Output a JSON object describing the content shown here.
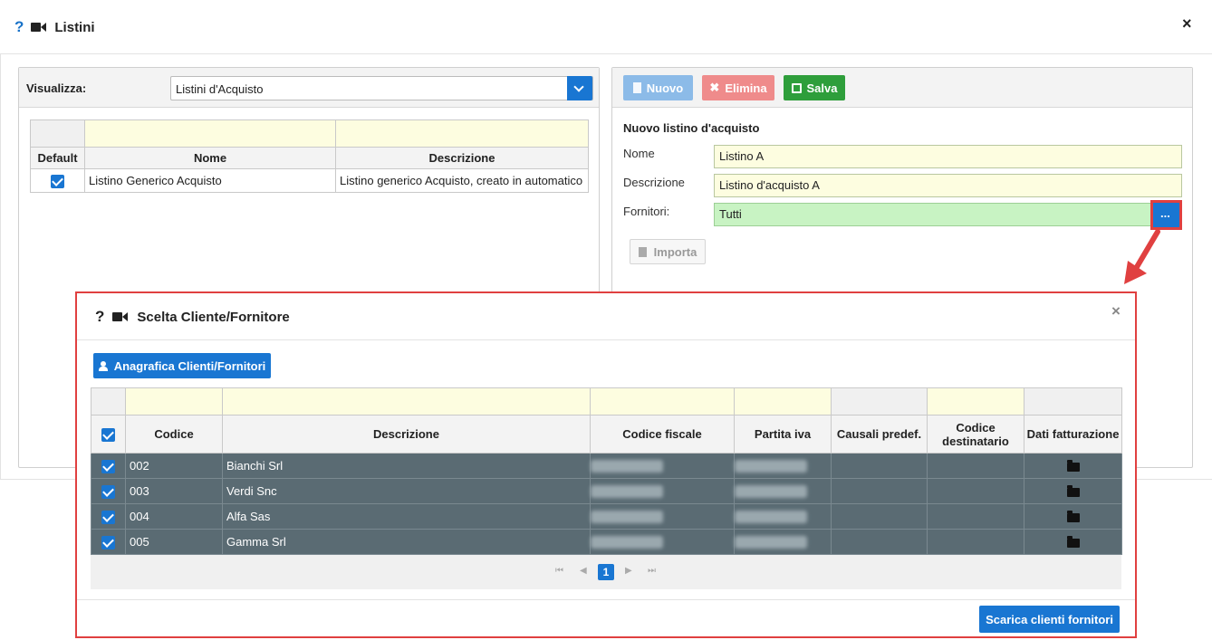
{
  "window": {
    "title": "Listini",
    "help_glyph": "?",
    "close_glyph": "×"
  },
  "left": {
    "visualizza_label": "Visualizza:",
    "visualizza_value": "Listini d'Acquisto",
    "columns": [
      "Default",
      "Nome",
      "Descrizione"
    ],
    "rows": [
      {
        "default": true,
        "nome": "Listino Generico Acquisto",
        "descrizione": "Listino generico Acquisto, creato in automatico"
      }
    ]
  },
  "toolbar": {
    "nuovo": "Nuovo",
    "elimina": "Elimina",
    "salva": "Salva"
  },
  "form": {
    "section_title": "Nuovo listino d'acquisto",
    "nome_label": "Nome",
    "nome_value": "Listino A",
    "descrizione_label": "Descrizione",
    "descrizione_value": "Listino d'acquisto A",
    "fornitori_label": "Fornitori:",
    "fornitori_value": "Tutti",
    "browse_label": "...",
    "importa": "Importa"
  },
  "modal": {
    "title": "Scelta Cliente/Fornitore",
    "help_glyph": "?",
    "close_glyph": "×",
    "anagrafica_button": "Anagrafica Clienti/Fornitori",
    "columns": [
      "Codice",
      "Descrizione",
      "Codice fiscale",
      "Partita iva",
      "Causali predef.",
      "Codice destinatario",
      "Dati fatturazione"
    ],
    "rows": [
      {
        "checked": true,
        "codice": "002",
        "descrizione": "Bianchi Srl"
      },
      {
        "checked": true,
        "codice": "003",
        "descrizione": "Verdi Snc"
      },
      {
        "checked": true,
        "codice": "004",
        "descrizione": "Alfa Sas"
      },
      {
        "checked": true,
        "codice": "005",
        "descrizione": "Gamma Srl"
      }
    ],
    "pager": {
      "current_page": "1"
    },
    "download_button": "Scarica clienti fornitori"
  },
  "colors": {
    "accent": "#1976d2",
    "danger": "#e04040",
    "success": "#2e9e3b",
    "row_dark": "#5a6b73"
  }
}
